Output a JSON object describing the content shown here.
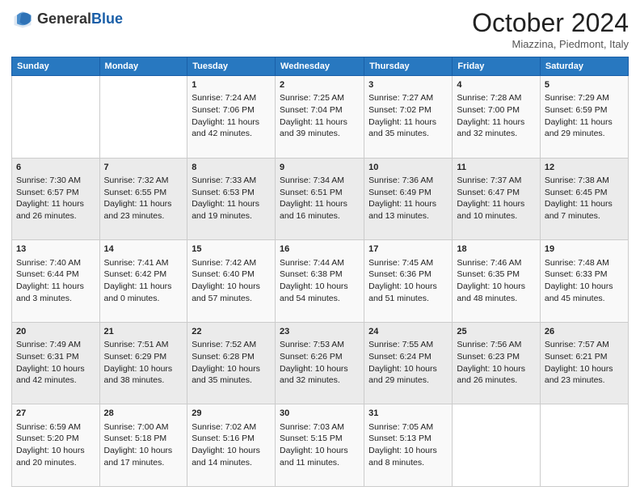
{
  "header": {
    "logo_general": "General",
    "logo_blue": "Blue",
    "month_title": "October 2024",
    "location": "Miazzina, Piedmont, Italy"
  },
  "days_of_week": [
    "Sunday",
    "Monday",
    "Tuesday",
    "Wednesday",
    "Thursday",
    "Friday",
    "Saturday"
  ],
  "weeks": [
    [
      {
        "day": "",
        "content": ""
      },
      {
        "day": "",
        "content": ""
      },
      {
        "day": "1",
        "content": "Sunrise: 7:24 AM\nSunset: 7:06 PM\nDaylight: 11 hours and 42 minutes."
      },
      {
        "day": "2",
        "content": "Sunrise: 7:25 AM\nSunset: 7:04 PM\nDaylight: 11 hours and 39 minutes."
      },
      {
        "day": "3",
        "content": "Sunrise: 7:27 AM\nSunset: 7:02 PM\nDaylight: 11 hours and 35 minutes."
      },
      {
        "day": "4",
        "content": "Sunrise: 7:28 AM\nSunset: 7:00 PM\nDaylight: 11 hours and 32 minutes."
      },
      {
        "day": "5",
        "content": "Sunrise: 7:29 AM\nSunset: 6:59 PM\nDaylight: 11 hours and 29 minutes."
      }
    ],
    [
      {
        "day": "6",
        "content": "Sunrise: 7:30 AM\nSunset: 6:57 PM\nDaylight: 11 hours and 26 minutes."
      },
      {
        "day": "7",
        "content": "Sunrise: 7:32 AM\nSunset: 6:55 PM\nDaylight: 11 hours and 23 minutes."
      },
      {
        "day": "8",
        "content": "Sunrise: 7:33 AM\nSunset: 6:53 PM\nDaylight: 11 hours and 19 minutes."
      },
      {
        "day": "9",
        "content": "Sunrise: 7:34 AM\nSunset: 6:51 PM\nDaylight: 11 hours and 16 minutes."
      },
      {
        "day": "10",
        "content": "Sunrise: 7:36 AM\nSunset: 6:49 PM\nDaylight: 11 hours and 13 minutes."
      },
      {
        "day": "11",
        "content": "Sunrise: 7:37 AM\nSunset: 6:47 PM\nDaylight: 11 hours and 10 minutes."
      },
      {
        "day": "12",
        "content": "Sunrise: 7:38 AM\nSunset: 6:45 PM\nDaylight: 11 hours and 7 minutes."
      }
    ],
    [
      {
        "day": "13",
        "content": "Sunrise: 7:40 AM\nSunset: 6:44 PM\nDaylight: 11 hours and 3 minutes."
      },
      {
        "day": "14",
        "content": "Sunrise: 7:41 AM\nSunset: 6:42 PM\nDaylight: 11 hours and 0 minutes."
      },
      {
        "day": "15",
        "content": "Sunrise: 7:42 AM\nSunset: 6:40 PM\nDaylight: 10 hours and 57 minutes."
      },
      {
        "day": "16",
        "content": "Sunrise: 7:44 AM\nSunset: 6:38 PM\nDaylight: 10 hours and 54 minutes."
      },
      {
        "day": "17",
        "content": "Sunrise: 7:45 AM\nSunset: 6:36 PM\nDaylight: 10 hours and 51 minutes."
      },
      {
        "day": "18",
        "content": "Sunrise: 7:46 AM\nSunset: 6:35 PM\nDaylight: 10 hours and 48 minutes."
      },
      {
        "day": "19",
        "content": "Sunrise: 7:48 AM\nSunset: 6:33 PM\nDaylight: 10 hours and 45 minutes."
      }
    ],
    [
      {
        "day": "20",
        "content": "Sunrise: 7:49 AM\nSunset: 6:31 PM\nDaylight: 10 hours and 42 minutes."
      },
      {
        "day": "21",
        "content": "Sunrise: 7:51 AM\nSunset: 6:29 PM\nDaylight: 10 hours and 38 minutes."
      },
      {
        "day": "22",
        "content": "Sunrise: 7:52 AM\nSunset: 6:28 PM\nDaylight: 10 hours and 35 minutes."
      },
      {
        "day": "23",
        "content": "Sunrise: 7:53 AM\nSunset: 6:26 PM\nDaylight: 10 hours and 32 minutes."
      },
      {
        "day": "24",
        "content": "Sunrise: 7:55 AM\nSunset: 6:24 PM\nDaylight: 10 hours and 29 minutes."
      },
      {
        "day": "25",
        "content": "Sunrise: 7:56 AM\nSunset: 6:23 PM\nDaylight: 10 hours and 26 minutes."
      },
      {
        "day": "26",
        "content": "Sunrise: 7:57 AM\nSunset: 6:21 PM\nDaylight: 10 hours and 23 minutes."
      }
    ],
    [
      {
        "day": "27",
        "content": "Sunrise: 6:59 AM\nSunset: 5:20 PM\nDaylight: 10 hours and 20 minutes."
      },
      {
        "day": "28",
        "content": "Sunrise: 7:00 AM\nSunset: 5:18 PM\nDaylight: 10 hours and 17 minutes."
      },
      {
        "day": "29",
        "content": "Sunrise: 7:02 AM\nSunset: 5:16 PM\nDaylight: 10 hours and 14 minutes."
      },
      {
        "day": "30",
        "content": "Sunrise: 7:03 AM\nSunset: 5:15 PM\nDaylight: 10 hours and 11 minutes."
      },
      {
        "day": "31",
        "content": "Sunrise: 7:05 AM\nSunset: 5:13 PM\nDaylight: 10 hours and 8 minutes."
      },
      {
        "day": "",
        "content": ""
      },
      {
        "day": "",
        "content": ""
      }
    ]
  ]
}
